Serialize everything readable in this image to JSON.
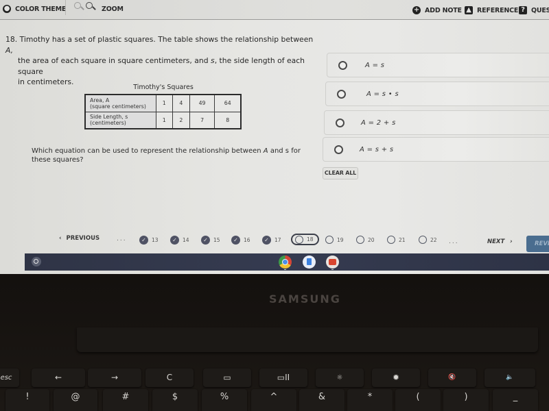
{
  "toolbar": {
    "color_theme": "COLOR THEME",
    "zoom": "ZOOM",
    "add_note": "ADD NOTE",
    "reference": "REFERENCE",
    "question_menu": "QUEST",
    "icons": [
      "palette-icon",
      "zoom-out-icon",
      "zoom-in-icon",
      "add-note-icon",
      "reference-icon",
      "question-icon"
    ]
  },
  "question": {
    "number": "18.",
    "line1": "Timothy has a set of plastic squares. The table shows the relationship between ",
    "line1_var": "A,",
    "line2a": "the area of each square in square centimeters, and ",
    "line2_var": "s",
    "line2b": ", the side length of each square",
    "line3": "in centimeters.",
    "prompt_a": "Which equation can be used to represent the relationship between ",
    "prompt_var": "A",
    "prompt_b": " and s for these squares?"
  },
  "table": {
    "title": "Timothy's Squares",
    "rows": [
      {
        "header_line1": "Area, A",
        "header_line2": "(square centimeters)",
        "values": [
          "1",
          "4",
          "49",
          "64"
        ]
      },
      {
        "header_line1": "Side Length, s",
        "header_line2": "(centimeters)",
        "values": [
          "1",
          "2",
          "7",
          "8"
        ]
      }
    ]
  },
  "answers": [
    {
      "label": "A = s",
      "selected": false
    },
    {
      "label": "A = s • s",
      "selected": false
    },
    {
      "label": "A = 2 + s",
      "selected": false
    },
    {
      "label": "A = s + s",
      "selected": false
    }
  ],
  "clear_all": "CLEAR ALL",
  "navigation": {
    "previous": "PREVIOUS",
    "previous_icon": "‹",
    "ellipsis": "...",
    "questions": [
      {
        "num": "13",
        "status": "answered"
      },
      {
        "num": "14",
        "status": "answered"
      },
      {
        "num": "15",
        "status": "answered"
      },
      {
        "num": "16",
        "status": "answered"
      },
      {
        "num": "17",
        "status": "answered"
      },
      {
        "num": "18",
        "status": "current"
      },
      {
        "num": "19",
        "status": "unanswered"
      },
      {
        "num": "20",
        "status": "unanswered"
      },
      {
        "num": "21",
        "status": "unanswered"
      },
      {
        "num": "22",
        "status": "unanswered"
      }
    ],
    "next": "NEXT",
    "next_icon": "›",
    "review": "REVI"
  },
  "shelf": {
    "apps": [
      "chrome",
      "docs",
      "youtube"
    ]
  },
  "bezel": {
    "brand": "SAMSUNG"
  },
  "keyboard": {
    "function_row": [
      "esc",
      "←",
      "→",
      "C",
      "▭",
      "▭II",
      "☼",
      "✹",
      "🔇",
      "🔈"
    ],
    "number_row": [
      "!",
      "@",
      "#",
      "$",
      "%",
      "^",
      "&",
      "*",
      "(",
      ")",
      "_"
    ]
  },
  "colors": {
    "check_badge": "#4f5264",
    "review_button": "#4a6d8f",
    "shelf": "#323749"
  }
}
